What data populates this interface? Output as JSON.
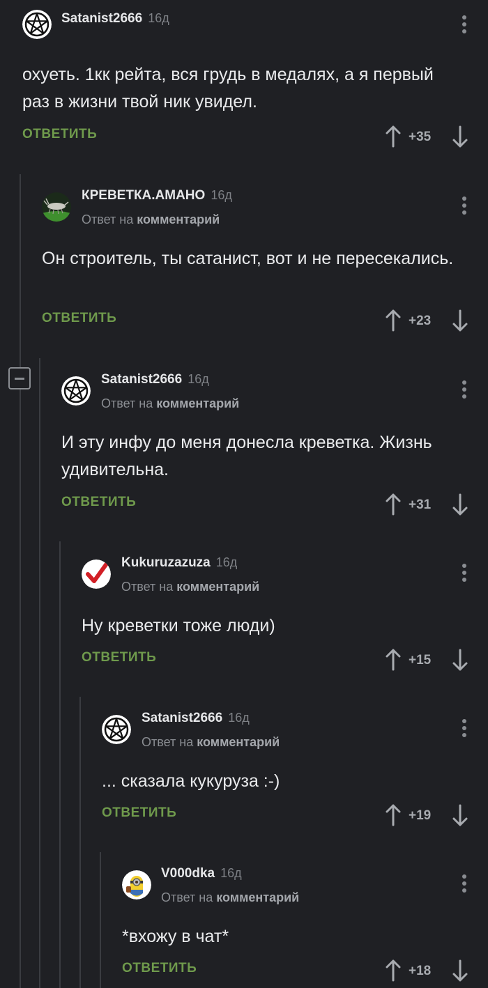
{
  "labels": {
    "reply": "ОТВЕТИТЬ",
    "reply_prefix": "Ответ на",
    "reply_target": "комментарий"
  },
  "comments": [
    {
      "author": "Satanist2666",
      "time": "16д",
      "text": "охуеть. 1кк рейта, вся грудь в медалях, а я первый раз в жизни твой ник увидел.",
      "score": "+35",
      "avatar": "pentagram-avatar"
    },
    {
      "author": "КРЕВЕТКА.АМАНО",
      "time": "16д",
      "text": "Он строитель, ты сатанист, вот и не пересекались.",
      "score": "+23",
      "avatar": "shrimp-avatar"
    },
    {
      "author": "Satanist2666",
      "time": "16д",
      "text": "И эту инфу до меня донесла креветка. Жизнь удивительна.",
      "score": "+31",
      "avatar": "pentagram-avatar"
    },
    {
      "author": "Kukuruzazuza",
      "time": "16д",
      "text": "Ну креветки тоже люди)",
      "score": "+15",
      "avatar": "checkmark-avatar"
    },
    {
      "author": "Satanist2666",
      "time": "16д",
      "text": "... сказала кукуруза :-)",
      "score": "+19",
      "avatar": "pentagram-avatar"
    },
    {
      "author": "V000dka",
      "time": "16д",
      "text": "*вхожу в чат*",
      "score": "+18",
      "avatar": "minion-avatar"
    }
  ]
}
